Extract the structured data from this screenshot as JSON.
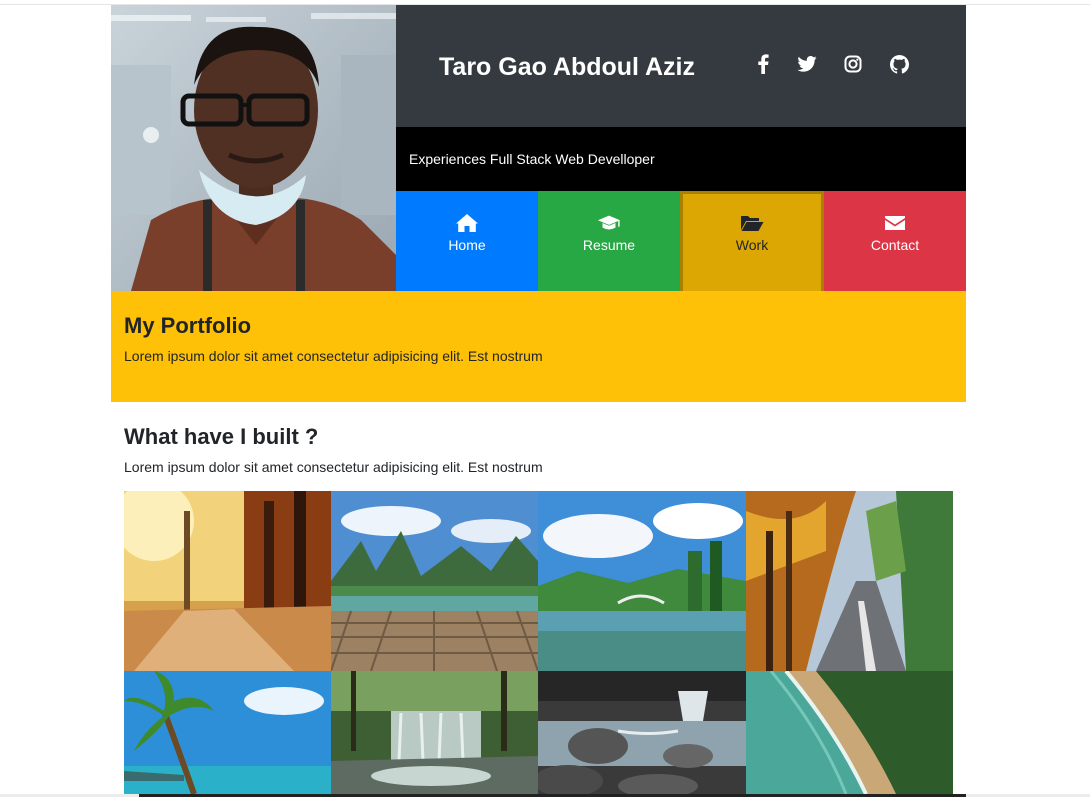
{
  "header": {
    "name": "Taro Gao Abdoul Aziz",
    "tagline": "Experiences Full Stack Web Develloper",
    "social": [
      {
        "icon": "facebook-icon"
      },
      {
        "icon": "twitter-icon"
      },
      {
        "icon": "instagram-icon"
      },
      {
        "icon": "github-icon"
      }
    ]
  },
  "nav": {
    "items": [
      {
        "label": "Home",
        "icon": "home-icon",
        "color": "#007bff"
      },
      {
        "label": "Resume",
        "icon": "graduation-cap-icon",
        "color": "#28a745"
      },
      {
        "label": "Work",
        "icon": "folder-open-icon",
        "color": "#dca702",
        "active": true
      },
      {
        "label": "Contact",
        "icon": "envelope-icon",
        "color": "#dc3545"
      }
    ]
  },
  "portfolio": {
    "title": "My Portfolio",
    "text": "Lorem ipsum dolor sit amet consectetur adipisicing elit. Est nostrum",
    "background": "#ffc107"
  },
  "built": {
    "title": "What have I built ?",
    "text": "Lorem ipsum dolor sit amet consectetur adipisicing elit. Est nostrum"
  },
  "gallery": {
    "images": [
      {
        "subject": "autumn-forest-path"
      },
      {
        "subject": "karst-mountains-lake-pier"
      },
      {
        "subject": "park-lake-bridge"
      },
      {
        "subject": "autumn-road"
      },
      {
        "subject": "palm-beach"
      },
      {
        "subject": "forest-waterfall"
      },
      {
        "subject": "rocky-stream"
      },
      {
        "subject": "coastline-aerial"
      }
    ]
  }
}
